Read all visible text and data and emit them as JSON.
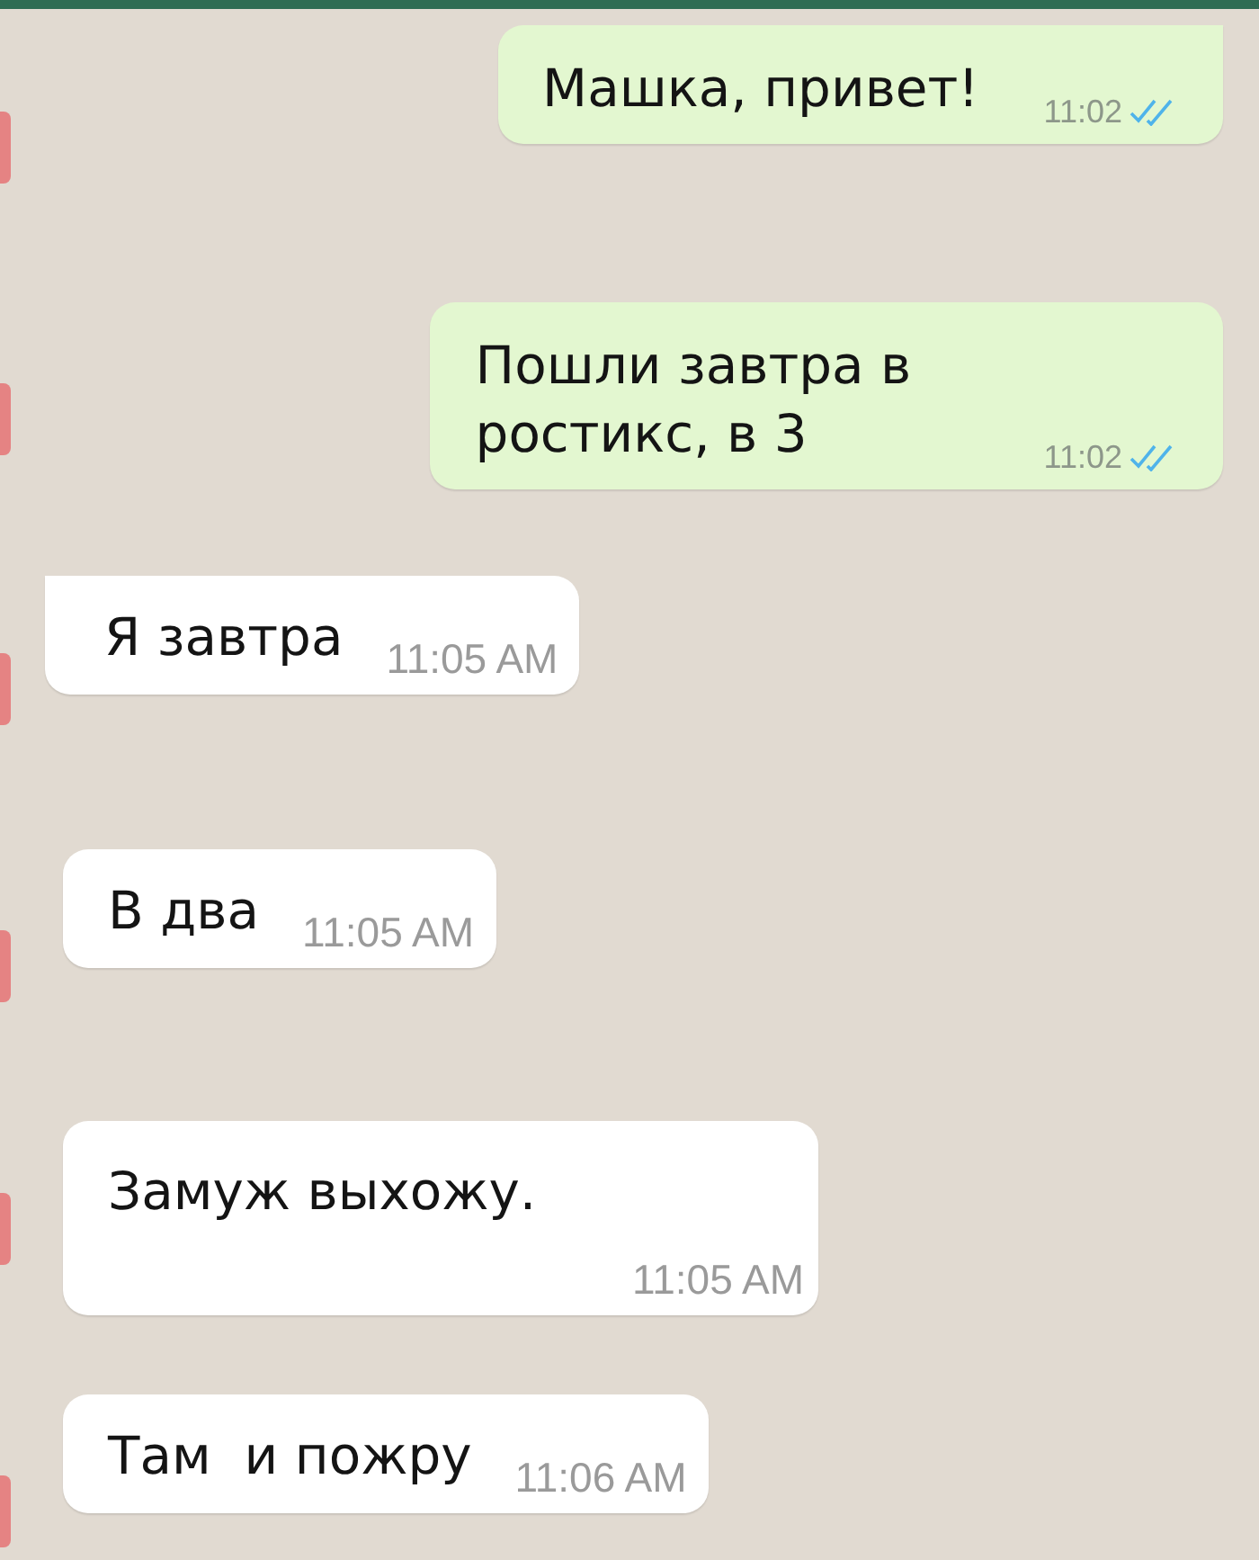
{
  "messages": [
    {
      "kind": "outgoing",
      "text": "Машка, привет!",
      "time": "11:02",
      "read": true
    },
    {
      "kind": "outgoing",
      "text": "Пошли завтра в ростикс, в 3",
      "time": "11:02",
      "read": true
    },
    {
      "kind": "incoming",
      "text": "Я завтра",
      "time": "11:05 AM"
    },
    {
      "kind": "incoming",
      "text": "В два",
      "time": "11:05 AM"
    },
    {
      "kind": "incoming",
      "text": "Замуж выхожу.",
      "time": "11:05 AM"
    },
    {
      "kind": "incoming",
      "text": "Там  и пожру",
      "time": "11:06 AM"
    }
  ]
}
